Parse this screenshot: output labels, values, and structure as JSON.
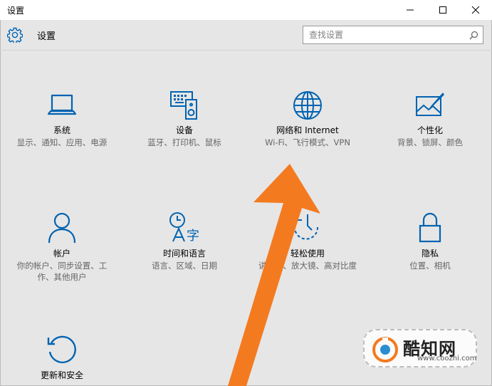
{
  "window": {
    "title": "设置"
  },
  "header": {
    "title": "设置"
  },
  "search": {
    "placeholder": "查找设置"
  },
  "tiles": [
    {
      "name": "系统",
      "desc": "显示、通知、应用、电源",
      "icon": "laptop-icon"
    },
    {
      "name": "设备",
      "desc": "蓝牙、打印机、鼠标",
      "icon": "devices-icon"
    },
    {
      "name": "网络和 Internet",
      "desc": "Wi-Fi、飞行模式、VPN",
      "icon": "globe-icon"
    },
    {
      "name": "个性化",
      "desc": "背景、锁屏、颜色",
      "icon": "personalization-icon"
    },
    {
      "name": "帐户",
      "desc": "你的帐户、同步设置、工作、其他用户",
      "icon": "person-icon"
    },
    {
      "name": "时间和语言",
      "desc": "语言、区域、日期",
      "icon": "time-language-icon"
    },
    {
      "name": "轻松使用",
      "desc": "讲述人、放大镜、高对比度",
      "icon": "ease-of-access-icon"
    },
    {
      "name": "隐私",
      "desc": "位置、相机",
      "icon": "lock-icon"
    },
    {
      "name": "更新和安全",
      "desc": "",
      "icon": "update-icon"
    }
  ],
  "watermark": {
    "title": "酷知网",
    "url": "www.coozhi.com"
  },
  "colors": {
    "accent": "#0063b1",
    "arrow": "#f47a20"
  }
}
